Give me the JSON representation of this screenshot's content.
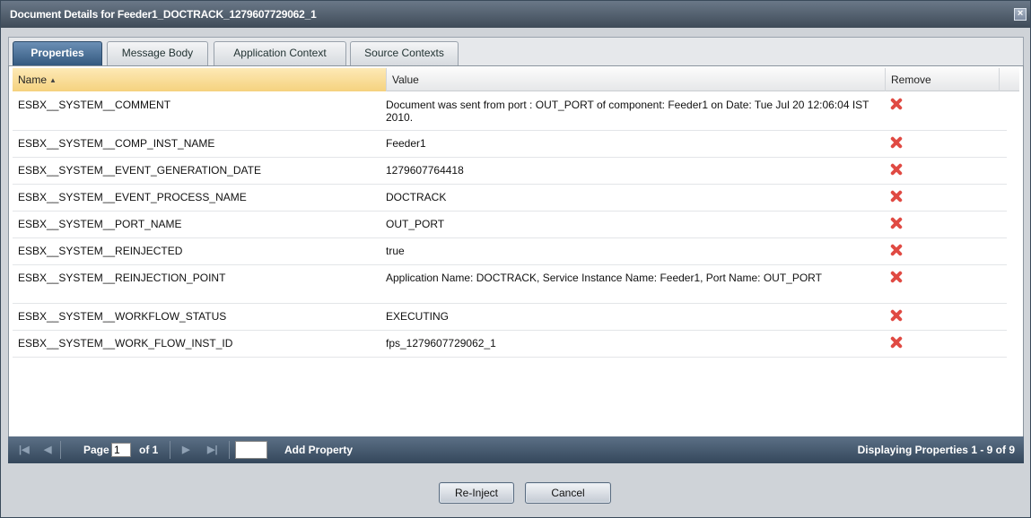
{
  "window": {
    "title": "Document Details for Feeder1_DOCTRACK_1279607729062_1",
    "close_glyph": "×"
  },
  "tabs": [
    {
      "label": "Properties",
      "active": true
    },
    {
      "label": "Message Body",
      "active": false
    },
    {
      "label": "Application Context",
      "active": false
    },
    {
      "label": "Source Contexts",
      "active": false
    }
  ],
  "grid": {
    "columns": {
      "name": "Name",
      "value": "Value",
      "remove": "Remove"
    },
    "sort_indicator": "▲",
    "rows": [
      {
        "name": "ESBX__SYSTEM__COMMENT",
        "value": "Document was sent from port : OUT_PORT of component: Feeder1 on Date: Tue Jul 20 12:06:04 IST 2010."
      },
      {
        "name": "ESBX__SYSTEM__COMP_INST_NAME",
        "value": "Feeder1"
      },
      {
        "name": "ESBX__SYSTEM__EVENT_GENERATION_DATE",
        "value": "1279607764418"
      },
      {
        "name": "ESBX__SYSTEM__EVENT_PROCESS_NAME",
        "value": "DOCTRACK"
      },
      {
        "name": "ESBX__SYSTEM__PORT_NAME",
        "value": "OUT_PORT"
      },
      {
        "name": "ESBX__SYSTEM__REINJECTED",
        "value": "true"
      },
      {
        "name": "ESBX__SYSTEM__REINJECTION_POINT",
        "value": "Application Name: DOCTRACK, Service Instance Name: Feeder1, Port Name: OUT_PORT"
      },
      {
        "name": "ESBX__SYSTEM__WORKFLOW_STATUS",
        "value": "EXECUTING"
      },
      {
        "name": "ESBX__SYSTEM__WORK_FLOW_INST_ID",
        "value": "fps_1279607729062_1"
      }
    ]
  },
  "pager": {
    "page_label": "Page",
    "page_value": "1",
    "of_label": "of 1",
    "add_property_label": "Add Property",
    "display_text": "Displaying Properties 1 - 9 of 9"
  },
  "buttons": {
    "reinject_label": "Re-Inject",
    "cancel_label": "Cancel"
  },
  "colors": {
    "remove_icon": "#e04a43",
    "active_tab": "#34597f",
    "sorted_header": "#f5d27e"
  }
}
